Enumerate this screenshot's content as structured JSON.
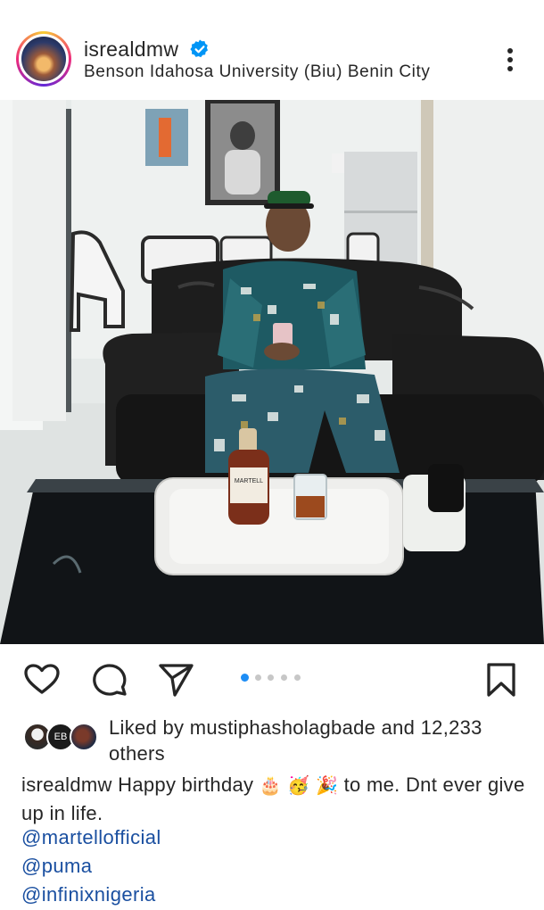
{
  "post": {
    "username": "isrealdmw",
    "location": "Benson Idahosa University (Biu) Benin City",
    "verified": true,
    "photo": {
      "bottle_label": "MARTELL"
    },
    "carousel": {
      "total": 5,
      "active_index": 0
    },
    "likes": {
      "text": "Liked by mustiphasholagbade and 12,233 others",
      "avatar_initials": [
        "",
        "EB",
        ""
      ]
    },
    "caption": {
      "username": "isrealdmw",
      "text_before": "Happy birthday",
      "emojis": [
        "🎂",
        "🥳",
        "🎉"
      ],
      "text_after": "to me. Dnt ever give up in life."
    },
    "mentions": [
      "@martellofficial",
      "@puma",
      "@infinixnigeria"
    ]
  },
  "icons": [
    "verified-badge-icon",
    "more-options-icon",
    "heart-icon",
    "comment-icon",
    "share-icon",
    "bookmark-icon"
  ],
  "colors": {
    "verified": "#0095f6",
    "link": "#1a4fa0",
    "carousel_active": "#1d8df5",
    "text": "#262626"
  }
}
